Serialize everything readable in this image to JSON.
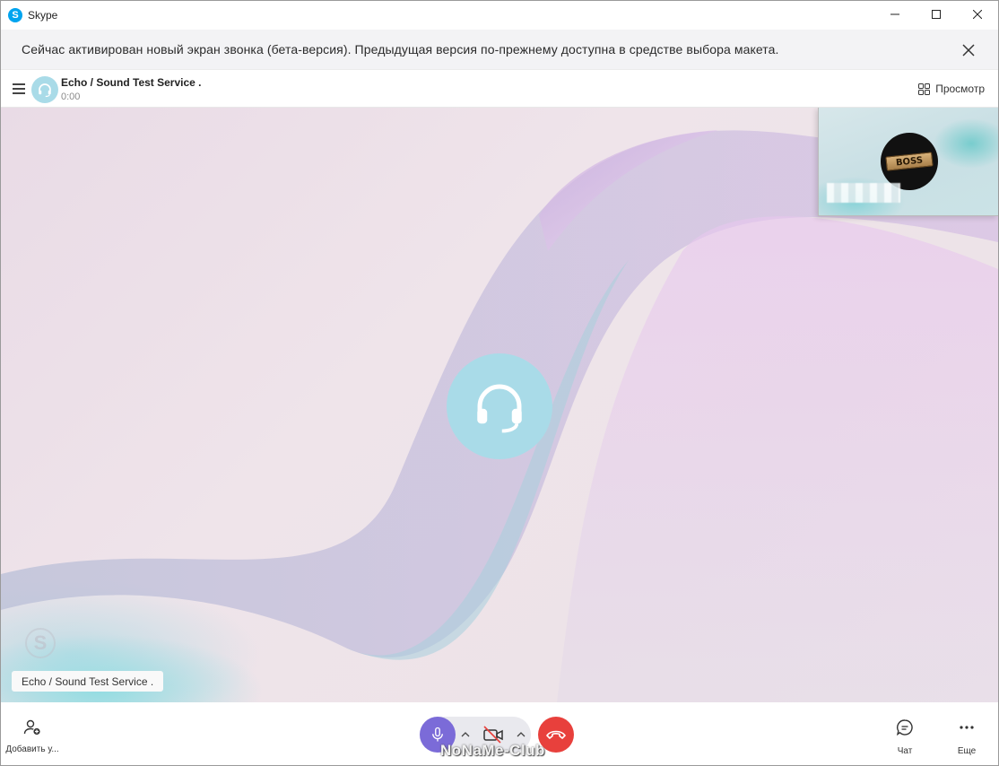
{
  "window": {
    "title": "Skype",
    "logo_letter": "S",
    "controls": [
      "minimize-icon",
      "maximize-icon",
      "close-icon"
    ]
  },
  "banner": {
    "text": "Сейчас активирован новый экран звонка (бета-версия). Предыдущая версия по-прежнему доступна в средстве выбора макета."
  },
  "call_header": {
    "name": "Echo / Sound Test Service .",
    "duration": "0:00",
    "view_label": "Просмотр"
  },
  "stage": {
    "participant_tag": "Echo / Sound Test Service .",
    "watermark_letter": "S",
    "self_view": {
      "avatar_text": "BOSS"
    }
  },
  "bottom_bar": {
    "add_user_label": "Добавить у...",
    "chat_label": "Чат",
    "more_label": "Еще",
    "overlay_watermark": "NoNaMe-Club"
  },
  "colors": {
    "mic_active": "#7b6bd8",
    "hangup": "#e8403c",
    "avatar_bg": "#a9dbe8",
    "brand": "#00a4ef"
  }
}
